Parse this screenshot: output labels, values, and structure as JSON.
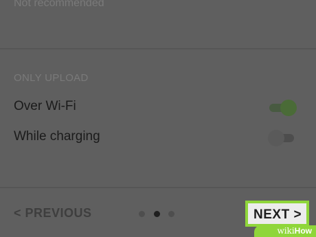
{
  "top_note": "Not recommended",
  "only_upload": {
    "header": "ONLY UPLOAD",
    "settings": [
      {
        "label": "Over Wi-Fi",
        "enabled": true
      },
      {
        "label": "While charging",
        "enabled": false
      }
    ]
  },
  "navigation": {
    "previous_label": "< PREVIOUS",
    "next_label": "NEXT >",
    "pages": {
      "total": 3,
      "current": 2
    }
  },
  "colors": {
    "highlight": "#8fd63a",
    "toggle_on": "#4a6b37"
  },
  "watermark": {
    "wiki": "wiki",
    "how": "How"
  }
}
